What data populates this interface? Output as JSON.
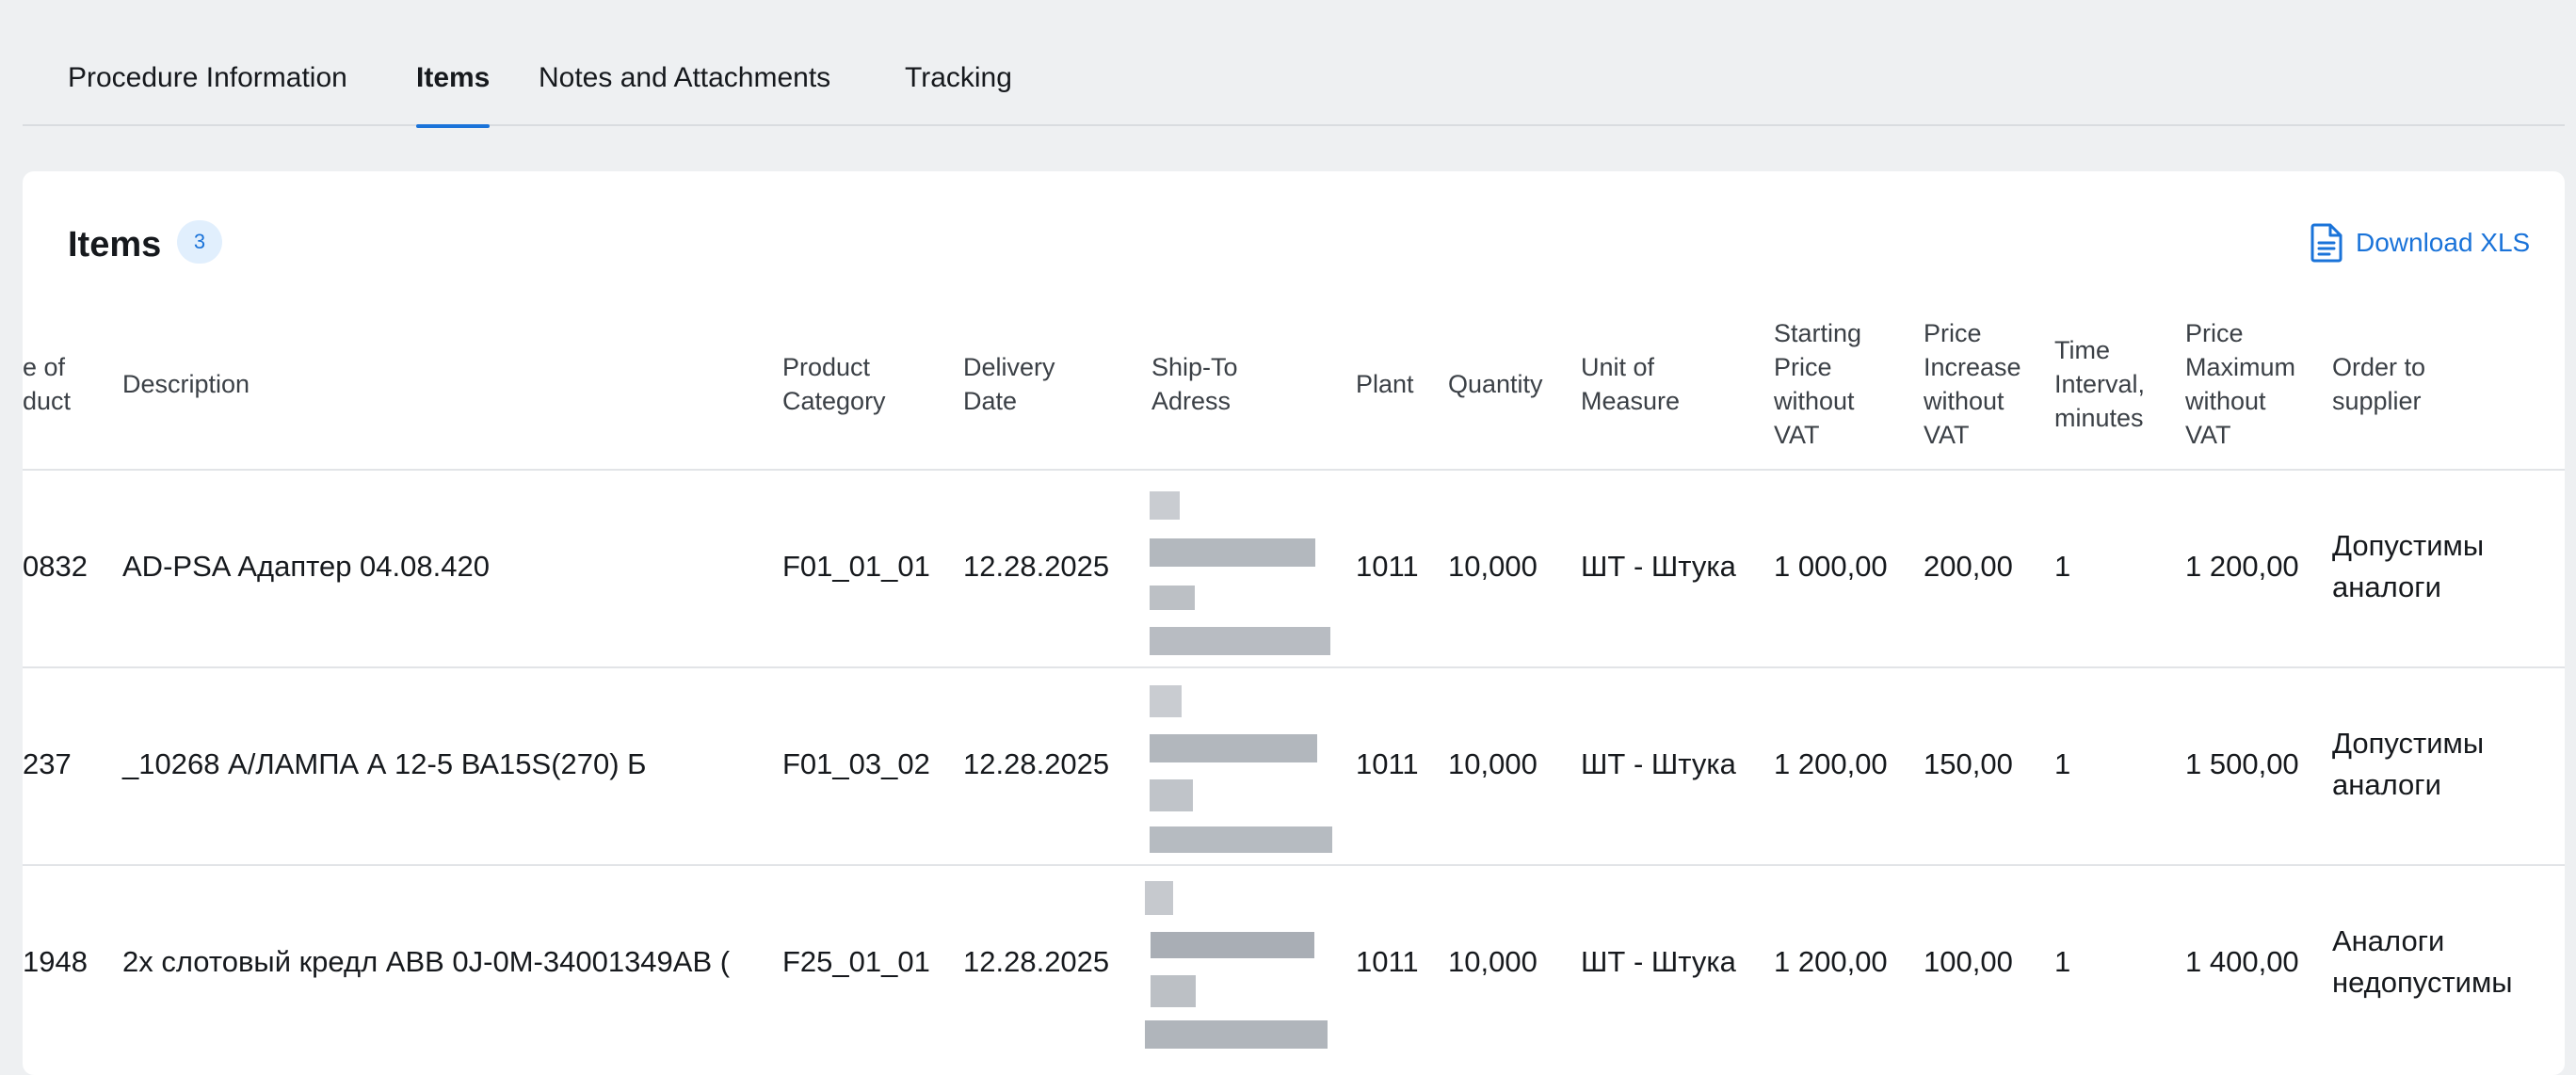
{
  "tabs": [
    {
      "label": "Procedure Information",
      "active": false
    },
    {
      "label": "Items",
      "active": true
    },
    {
      "label": "Notes and Attachments",
      "active": false
    },
    {
      "label": "Tracking",
      "active": false
    }
  ],
  "card": {
    "title": "Items",
    "count": "3",
    "download_label": "Download XLS",
    "download_icon": "document-icon"
  },
  "table": {
    "headers": {
      "code": [
        "e of",
        "duct"
      ],
      "description": [
        "Description"
      ],
      "category": [
        "Product",
        "Category"
      ],
      "delivery": [
        "Delivery",
        "Date"
      ],
      "shipto": [
        "Ship-To",
        "Adress"
      ],
      "plant": [
        "Plant"
      ],
      "quantity": [
        "Quantity"
      ],
      "uom": [
        "Unit of",
        "Measure"
      ],
      "start_price": [
        "Starting",
        "Price",
        "without",
        "VAT"
      ],
      "increase": [
        "Price",
        "Increase",
        "without",
        "VAT"
      ],
      "interval": [
        "Time",
        "Interval,",
        "minutes"
      ],
      "max_price": [
        "Price",
        "Maximum",
        "without",
        "VAT"
      ],
      "order": [
        "Order to",
        "supplier"
      ]
    },
    "rows": [
      {
        "code": "0832",
        "description": "AD-PSA Адаптер 04.08.420",
        "category": "F01_01_01",
        "delivery": "12.28.2025",
        "plant": "1011",
        "quantity": "10,000",
        "uom": "ШТ - Штука",
        "start_price": "1 000,00",
        "increase": "200,00",
        "interval": "1",
        "max_price": "1 200,00",
        "order": [
          "Допустимы",
          "аналоги"
        ]
      },
      {
        "code": "237",
        "description": "_10268 А/ЛАМПА А 12-5 ВА15S(270) Б",
        "category": "F01_03_02",
        "delivery": "12.28.2025",
        "plant": "1011",
        "quantity": "10,000",
        "uom": "ШТ - Штука",
        "start_price": "1 200,00",
        "increase": "150,00",
        "interval": "1",
        "max_price": "1 500,00",
        "order": [
          "Допустимы",
          "аналоги"
        ]
      },
      {
        "code": "1948",
        "description": "2х слотовый кредл ABB 0J-0M-34001349AB (",
        "category": "F25_01_01",
        "delivery": "12.28.2025",
        "plant": "1011",
        "quantity": "10,000",
        "uom": "ШТ - Штука",
        "start_price": "1 200,00",
        "increase": "100,00",
        "interval": "1",
        "max_price": "1 400,00",
        "order": [
          "Аналоги",
          "недопустимы"
        ]
      }
    ]
  }
}
